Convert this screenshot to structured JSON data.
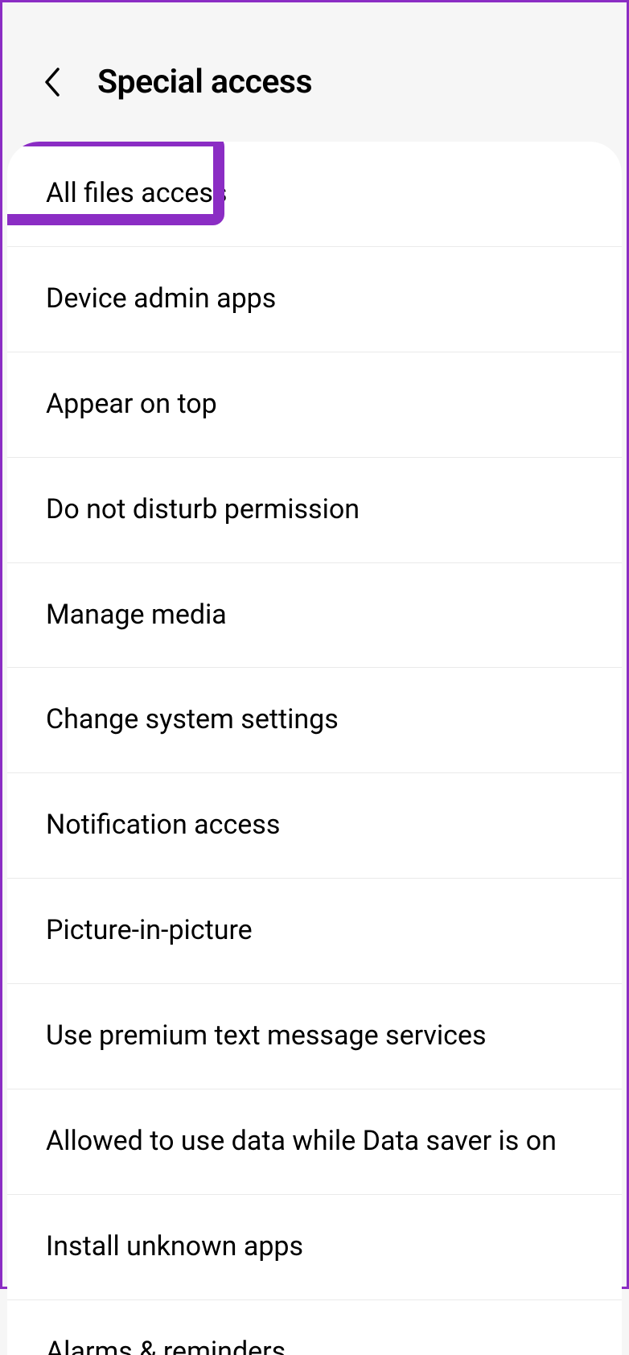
{
  "header": {
    "title": "Special access"
  },
  "items": [
    {
      "label": "All files access",
      "highlighted": true
    },
    {
      "label": "Device admin apps",
      "highlighted": false
    },
    {
      "label": "Appear on top",
      "highlighted": false
    },
    {
      "label": "Do not disturb permission",
      "highlighted": false
    },
    {
      "label": "Manage media",
      "highlighted": false
    },
    {
      "label": "Change system settings",
      "highlighted": false
    },
    {
      "label": "Notification access",
      "highlighted": false
    },
    {
      "label": "Picture-in-picture",
      "highlighted": false
    },
    {
      "label": "Use premium text message services",
      "highlighted": false
    },
    {
      "label": "Allowed to use data while Data saver is on",
      "highlighted": false
    },
    {
      "label": "Install unknown apps",
      "highlighted": false
    }
  ],
  "partial_item": {
    "label": "Alarms & reminders"
  },
  "highlight_color": "#8b2dc4"
}
